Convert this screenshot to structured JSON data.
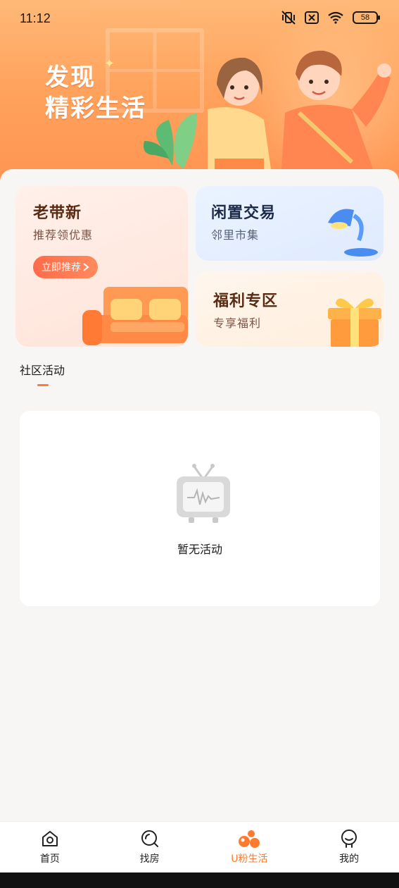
{
  "status_bar": {
    "time": "11:12",
    "battery": "58",
    "icons": [
      "vibrate-off-icon",
      "sim-off-icon",
      "wifi-icon",
      "battery-icon"
    ]
  },
  "hero": {
    "title_line1": "发现",
    "title_line2": "精彩生活"
  },
  "cards": {
    "laodaixin": {
      "title": "老带新",
      "subtitle": "推荐领优惠",
      "button": "立即推荐"
    },
    "xianzhi": {
      "title": "闲置交易",
      "subtitle": "邻里市集"
    },
    "fuli": {
      "title": "福利专区",
      "subtitle": "专享福利"
    }
  },
  "section": {
    "tab": "社区活动"
  },
  "empty": {
    "text": "暂无活动"
  },
  "nav": {
    "items": [
      {
        "label": "首页",
        "icon": "home-icon"
      },
      {
        "label": "找房",
        "icon": "search-icon"
      },
      {
        "label": "U粉生活",
        "icon": "ufen-life-icon",
        "active": true
      },
      {
        "label": "我的",
        "icon": "profile-icon"
      }
    ]
  },
  "colors": {
    "accent": "#ff7a2e",
    "hero_orange": "#ffa25c",
    "page_bg": "#f7f6f5"
  }
}
